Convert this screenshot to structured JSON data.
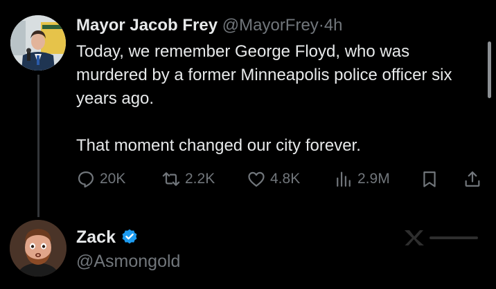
{
  "tweet": {
    "author_name": "Mayor Jacob Frey",
    "handle": "@MayorFrey",
    "separator": "·",
    "time": "4h",
    "body_paragraph_1": "Today, we remember George Floyd, who was murdered by a former Minneapolis police officer six years ago.",
    "body_paragraph_2": "That moment changed our city forever.",
    "actions": {
      "replies": {
        "icon": "reply-icon",
        "count": "20K"
      },
      "reposts": {
        "icon": "repost-icon",
        "count": "2.2K"
      },
      "likes": {
        "icon": "heart-icon",
        "count": "4.8K"
      },
      "views": {
        "icon": "views-bar-chart-icon",
        "count": "2.9M"
      },
      "bookmark": {
        "icon": "bookmark-icon"
      },
      "share": {
        "icon": "share-icon"
      }
    }
  },
  "reply": {
    "author_name": "Zack",
    "handle": "@Asmongold",
    "verified_icon": "verified-badge-icon"
  },
  "colors": {
    "background": "#000000",
    "primary_text": "#e7e9ea",
    "muted_text": "#71767b",
    "verified_blue": "#1d9bf0",
    "thread_line": "#333639"
  }
}
